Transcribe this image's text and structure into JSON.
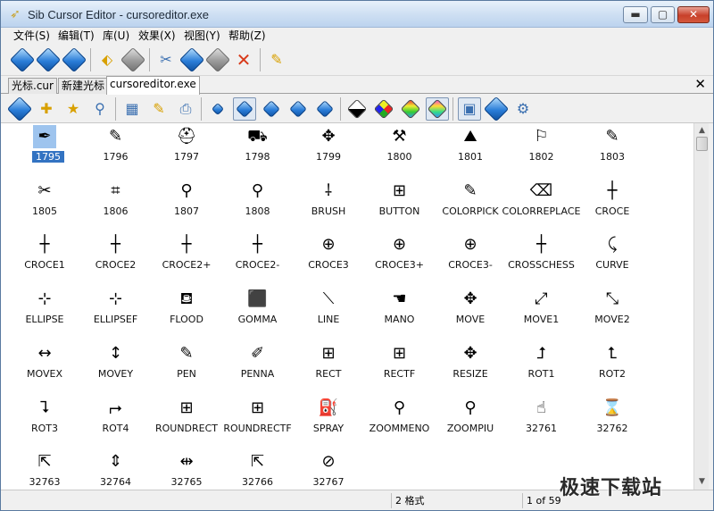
{
  "window": {
    "title": "Sib Cursor Editor - cursoreditor.exe",
    "controls": {
      "minimize": "▬",
      "maximize": "▢",
      "close": "✕"
    }
  },
  "menu": [
    "文件(S)",
    "编辑(T)",
    "库(U)",
    "效果(X)",
    "视图(Y)",
    "帮助(Z)"
  ],
  "tabs": [
    {
      "label": "光标.cur",
      "active": false
    },
    {
      "label": "新建光标",
      "active": false
    },
    {
      "label": "cursoreditor.exe",
      "active": true
    }
  ],
  "tabs_close": "✕",
  "toolbar_top": [
    "new-icon",
    "open-icon",
    "save-icon",
    "undo-icon",
    "redo-icon",
    "cut-icon",
    "copy-icon",
    "paste-icon",
    "delete-icon",
    "properties-icon"
  ],
  "toolbar_library": [
    "lib-open-icon",
    "lib-add-icon",
    "lib-favorite-icon",
    "lib-find-icon",
    "grid-view-icon",
    "pencil-tool-icon",
    "lib-export-icon",
    "size-small-icon",
    "size-medium-icon",
    "size-large-icon",
    "size-xlarge-icon",
    "size-custom-icon",
    "mono-icon",
    "color16-icon",
    "color256-icon",
    "truecolor-icon",
    "preview-icon",
    "animate-icon",
    "settings-icon"
  ],
  "cursors": [
    {
      "label": "1795",
      "glyph": "✒",
      "selected": true
    },
    {
      "label": "1796",
      "glyph": "✎"
    },
    {
      "label": "1797",
      "glyph": "⛑"
    },
    {
      "label": "1798",
      "glyph": "⛟"
    },
    {
      "label": "1799",
      "glyph": "✥"
    },
    {
      "label": "1800",
      "glyph": "⚒"
    },
    {
      "label": "1801",
      "glyph": "⛰"
    },
    {
      "label": "1802",
      "glyph": "⚐"
    },
    {
      "label": "1803",
      "glyph": "✎"
    },
    {
      "label": "1805",
      "glyph": "✂"
    },
    {
      "label": "1806",
      "glyph": "⌗"
    },
    {
      "label": "1807",
      "glyph": "⚲"
    },
    {
      "label": "1808",
      "glyph": "⚲"
    },
    {
      "label": "BRUSH",
      "glyph": "⸸"
    },
    {
      "label": "BUTTON",
      "glyph": "⊞"
    },
    {
      "label": "COLORPICK",
      "glyph": "✎"
    },
    {
      "label": "COLORREPLACE",
      "glyph": "⌫"
    },
    {
      "label": "CROCE",
      "glyph": "┼"
    },
    {
      "label": "CROCE1",
      "glyph": "┼"
    },
    {
      "label": "CROCE2",
      "glyph": "┼"
    },
    {
      "label": "CROCE2+",
      "glyph": "┼"
    },
    {
      "label": "CROCE2-",
      "glyph": "┼"
    },
    {
      "label": "CROCE3",
      "glyph": "⊕"
    },
    {
      "label": "CROCE3+",
      "glyph": "⊕"
    },
    {
      "label": "CROCE3-",
      "glyph": "⊕"
    },
    {
      "label": "CROSSCHESS",
      "glyph": "┼"
    },
    {
      "label": "CURVE",
      "glyph": "⤹"
    },
    {
      "label": "ELLIPSE",
      "glyph": "⊹"
    },
    {
      "label": "ELLIPSEF",
      "glyph": "⊹"
    },
    {
      "label": "FLOOD",
      "glyph": "⛾"
    },
    {
      "label": "GOMMA",
      "glyph": "⬛"
    },
    {
      "label": "LINE",
      "glyph": "⟍"
    },
    {
      "label": "MANO",
      "glyph": "☚"
    },
    {
      "label": "MOVE",
      "glyph": "✥"
    },
    {
      "label": "MOVE1",
      "glyph": "⤢"
    },
    {
      "label": "MOVE2",
      "glyph": "⤡"
    },
    {
      "label": "MOVEX",
      "glyph": "↔"
    },
    {
      "label": "MOVEY",
      "glyph": "↕"
    },
    {
      "label": "PEN",
      "glyph": "✎"
    },
    {
      "label": "PENNA",
      "glyph": "✐"
    },
    {
      "label": "RECT",
      "glyph": "⊞"
    },
    {
      "label": "RECTF",
      "glyph": "⊞"
    },
    {
      "label": "RESIZE",
      "glyph": "✥"
    },
    {
      "label": "ROT1",
      "glyph": "⮥"
    },
    {
      "label": "ROT2",
      "glyph": "⮤"
    },
    {
      "label": "ROT3",
      "glyph": "⮧"
    },
    {
      "label": "ROT4",
      "glyph": "⮣"
    },
    {
      "label": "ROUNDRECT",
      "glyph": "⊞"
    },
    {
      "label": "ROUNDRECTF",
      "glyph": "⊞"
    },
    {
      "label": "SPRAY",
      "glyph": "⛽"
    },
    {
      "label": "ZOOMMENO",
      "glyph": "⚲"
    },
    {
      "label": "ZOOMPIU",
      "glyph": "⚲"
    },
    {
      "label": "32761",
      "glyph": "☝"
    },
    {
      "label": "32762",
      "glyph": "⌛"
    },
    {
      "label": "32763",
      "glyph": "⇱"
    },
    {
      "label": "32764",
      "glyph": "⇕"
    },
    {
      "label": "32765",
      "glyph": "⇹"
    },
    {
      "label": "32766",
      "glyph": "⇱"
    },
    {
      "label": "32767",
      "glyph": "⊘"
    }
  ],
  "status": {
    "format": "2 格式",
    "page": "1 of 59"
  },
  "watermark": "极速下载站",
  "colors": {
    "selection": "#3373c2",
    "titlebar": "#cfe0f3"
  }
}
